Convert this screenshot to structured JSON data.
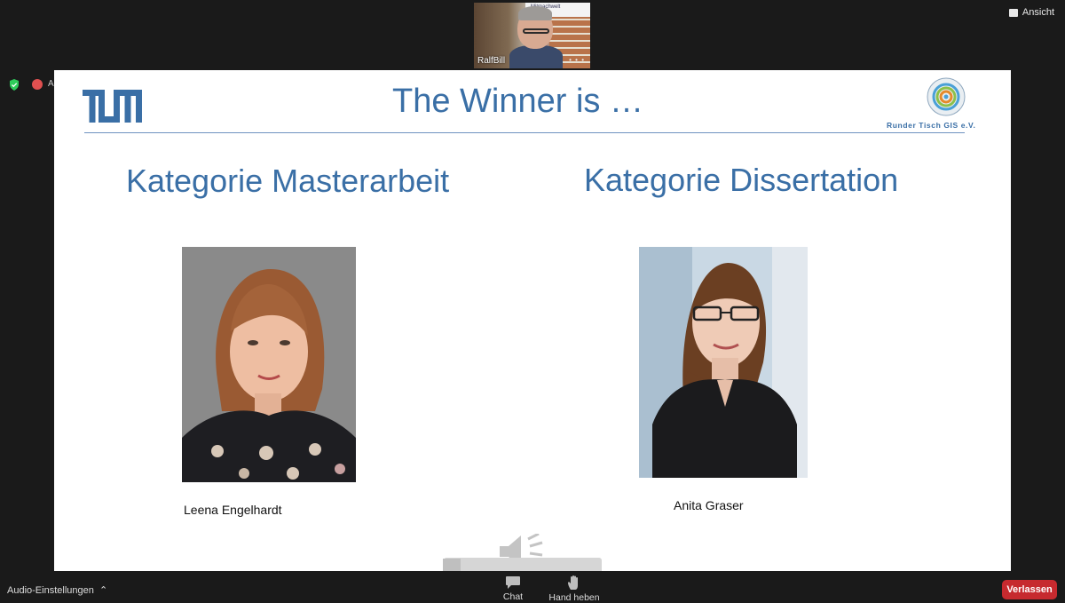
{
  "topbar": {
    "view_label": "Ansicht"
  },
  "video": {
    "participant_name": "RalfBill",
    "sign_text": "Mitmachwelt",
    "dots": "• • •"
  },
  "status": {
    "left_cut_text": "A"
  },
  "slide": {
    "title": "The Winner is …",
    "org_name": "Runder Tisch GIS e.V.",
    "category_left": "Kategorie Masterarbeit",
    "category_right": "Kategorie Dissertation",
    "winner_left": "Leena Engelhardt",
    "winner_right": "Anita Graser"
  },
  "toolbar": {
    "audio_settings": "Audio-Einstellungen",
    "chat": "Chat",
    "raise_hand": "Hand heben",
    "leave": "Verlassen"
  },
  "colors": {
    "accent_blue": "#3a6fa6",
    "leave_red": "#c62a2f",
    "background": "#1a1a1a"
  }
}
